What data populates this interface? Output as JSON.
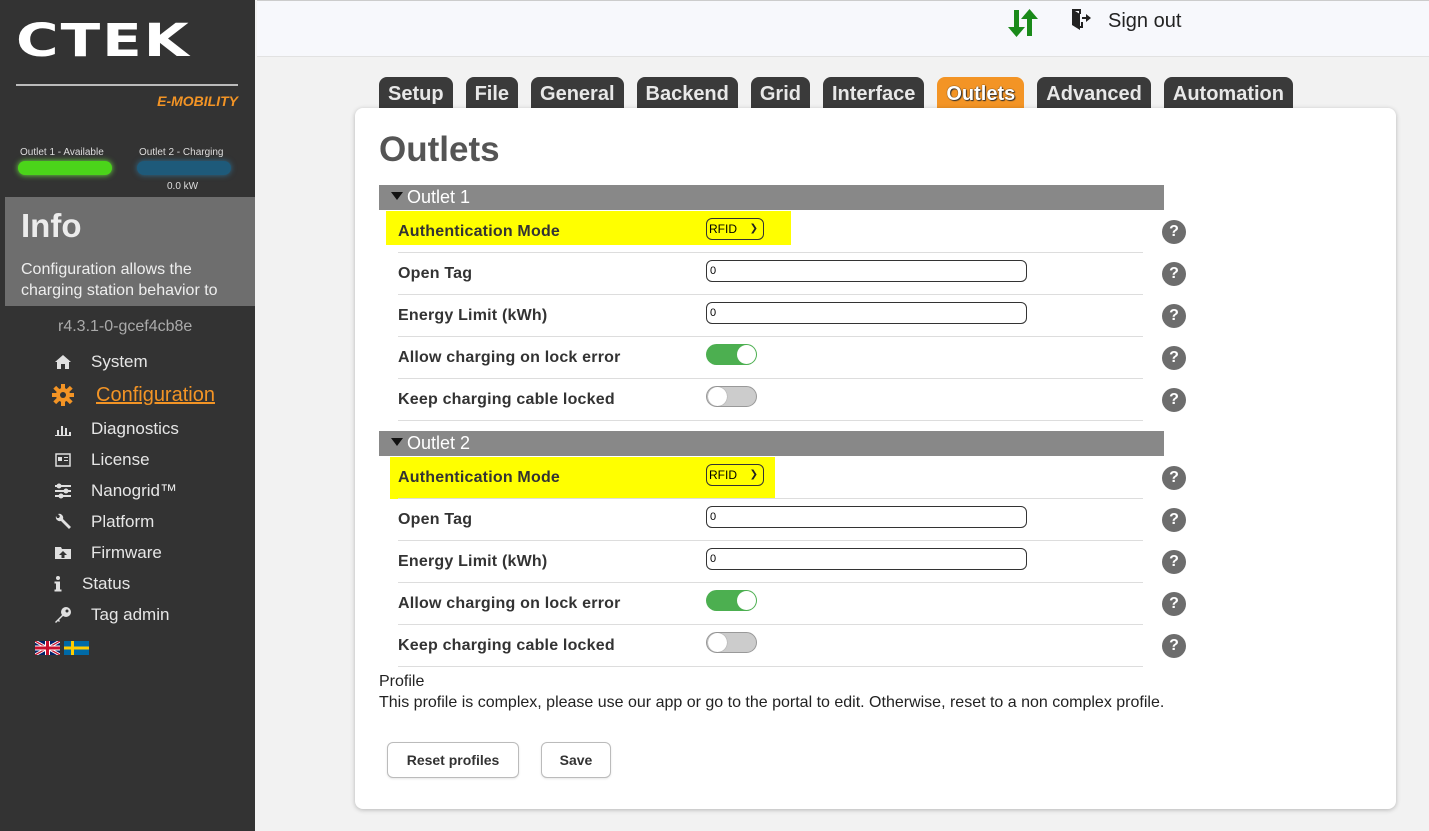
{
  "brand": {
    "name": "CTEK",
    "subtitle": "E-MOBILITY",
    "accent": "#f39425"
  },
  "outlet_status": [
    {
      "label": "Outlet 1 - Available",
      "color": "#4bd41a"
    },
    {
      "label": "Outlet 2 - Charging",
      "color": "#1e5a7a",
      "power": "0.0 kW"
    }
  ],
  "info": {
    "title": "Info",
    "text": "Configuration allows the charging station behavior to"
  },
  "version": "r4.3.1-0-gcef4cb8e",
  "nav": {
    "items": [
      {
        "label": "System",
        "icon": "home-icon"
      },
      {
        "label": "Configuration",
        "icon": "gear-icon",
        "active": true
      },
      {
        "label": "Diagnostics",
        "icon": "bar-chart-icon"
      },
      {
        "label": "License",
        "icon": "license-icon"
      },
      {
        "label": "Nanogrid™",
        "icon": "sliders-icon"
      },
      {
        "label": "Platform",
        "icon": "wrench-icon"
      },
      {
        "label": "Firmware",
        "icon": "upload-folder-icon"
      },
      {
        "label": "Status",
        "icon": "info-icon"
      },
      {
        "label": "Tag admin",
        "icon": "key-icon"
      }
    ]
  },
  "languages": [
    "english-flag-icon",
    "swedish-flag-icon"
  ],
  "topbar": {
    "signout": "Sign out"
  },
  "tabs": [
    "Setup",
    "File",
    "General",
    "Backend",
    "Grid",
    "Interface",
    "Outlets",
    "Advanced",
    "Automation"
  ],
  "active_tab": "Outlets",
  "page": {
    "title": "Outlets"
  },
  "outlets": [
    {
      "title": "Outlet 1",
      "auth_label": "Authentication Mode",
      "auth_value": "RFID",
      "open_tag_label": "Open Tag",
      "open_tag_value": "0",
      "energy_label": "Energy Limit (kWh)",
      "energy_value": "0",
      "lock_error_label": "Allow charging on lock error",
      "lock_error_on": true,
      "keep_locked_label": "Keep charging cable locked",
      "keep_locked_on": false
    },
    {
      "title": "Outlet 2",
      "auth_label": "Authentication Mode",
      "auth_value": "RFID",
      "open_tag_label": "Open Tag",
      "open_tag_value": "0",
      "energy_label": "Energy Limit (kWh)",
      "energy_value": "0",
      "lock_error_label": "Allow charging on lock error",
      "lock_error_on": true,
      "keep_locked_label": "Keep charging cable locked",
      "keep_locked_on": false
    }
  ],
  "help_symbol": "?",
  "profile": {
    "title": "Profile",
    "text": "This profile is complex, please use our app or go to the portal to edit. Otherwise, reset to a non complex profile."
  },
  "buttons": {
    "reset": "Reset profiles",
    "save": "Save"
  },
  "colors": {
    "highlight": "#ffff00",
    "toggle_on": "#4caf50",
    "sidebar_bg": "#333333",
    "section_bg": "#888888"
  }
}
